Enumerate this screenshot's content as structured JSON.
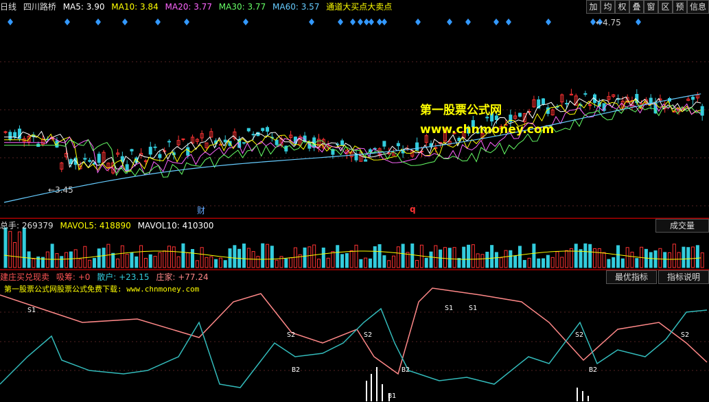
{
  "main": {
    "period": "日线",
    "stock_name": "四川路桥",
    "ma": [
      {
        "label": "MA5: 3.90",
        "color": "#ffffff"
      },
      {
        "label": "MA10: 3.84",
        "color": "#ffff00"
      },
      {
        "label": "MA20: 3.77",
        "color": "#ff66ff"
      },
      {
        "label": "MA30: 3.77",
        "color": "#66ff66"
      },
      {
        "label": "MA60: 3.57",
        "color": "#66ccff"
      }
    ],
    "signal_label": "通道大买点大卖点",
    "high_label": "4.75",
    "low_label": "3.45",
    "marker_cai": "财",
    "marker_q": "q",
    "toolbar": [
      "加",
      "均",
      "权",
      "叠",
      "窗",
      "区",
      "预",
      "信息"
    ],
    "watermark_cn": "第一股票公式网",
    "watermark_url": "www.chnmoney.com"
  },
  "volume": {
    "total": "总手: 269379",
    "mavol5": "MAVOL5: 418890",
    "mavol10": "MAVOL10: 410300",
    "tab": "成交量"
  },
  "indicator": {
    "name": "建庄买兑现卖",
    "xichou": "吸筹: +0",
    "sanhu": "散户: +23.15",
    "zhuangjia": "庄家: +77.24",
    "tab_best": "最优指标",
    "tab_help": "指标说明",
    "subtitle": "第一股票公式网股票公式免费下载: www.chnmoney.com",
    "labels": [
      "S1",
      "S2",
      "B2",
      "S2",
      "B2",
      "S1",
      "S1",
      "S2",
      "B2",
      "S2",
      "B1"
    ]
  },
  "colors": {
    "up": "#ff3333",
    "down": "#33ccdd",
    "pink_line": "#ff8888",
    "cyan_line": "#33bbbb",
    "divider": "#aa0000"
  }
}
